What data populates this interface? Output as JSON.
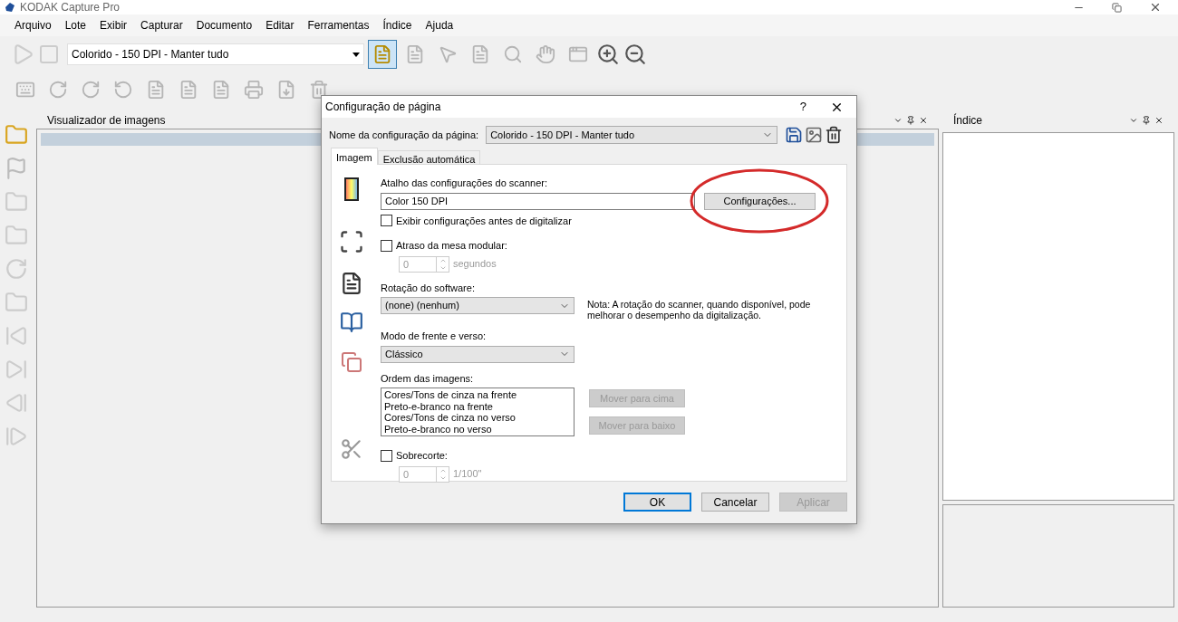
{
  "window": {
    "title": "KODAK Capture Pro"
  },
  "menu": [
    "Arquivo",
    "Lote",
    "Exibir",
    "Capturar",
    "Documento",
    "Editar",
    "Ferramentas",
    "Índice",
    "Ajuda"
  ],
  "toolbar": {
    "setup_combo": "Colorido - 150 DPI - Manter tudo"
  },
  "viewer_panel": {
    "title": "Visualizador de imagens"
  },
  "index_panel": {
    "title": "Índice"
  },
  "dialog": {
    "title": "Configuração de página",
    "help": "?",
    "name_label": "Nome da configuração da página:",
    "name_value": "Colorido - 150 DPI - Manter tudo",
    "tabs": [
      {
        "label": "Imagem",
        "selected": true
      },
      {
        "label": "Exclusão automática",
        "selected": false
      }
    ],
    "scanner": {
      "label": "Atalho das configurações do scanner:",
      "value": "Color 150 DPI",
      "button": "Configurações...",
      "show_before": {
        "label": "Exibir configurações antes de digitalizar",
        "checked": false
      }
    },
    "flatbed": {
      "label": "Atraso da mesa modular:",
      "checked": false,
      "value": "0",
      "unit": "segundos",
      "disabled": true
    },
    "rotation": {
      "label": "Rotação do software:",
      "value": "(none) (nenhum)",
      "note": "Nota: A rotação do scanner, quando disponível, pode melhorar o desempenho da digitalização."
    },
    "duplex": {
      "label": "Modo de frente e verso:",
      "value": "Clássico"
    },
    "order": {
      "label": "Ordem das imagens:",
      "items": [
        "Cores/Tons de cinza na frente",
        "Preto-e-branco na frente",
        "Cores/Tons de cinza no verso",
        "Preto-e-branco no verso"
      ],
      "buttons": [
        {
          "label": "Mover para cima",
          "disabled": true
        },
        {
          "label": "Mover para baixo",
          "disabled": true
        }
      ]
    },
    "overscan": {
      "label": "Sobrecorte:",
      "checked": false,
      "value": "0",
      "unit": "1/100\"",
      "disabled": true
    },
    "buttons": [
      {
        "label": "OK",
        "kind": "default",
        "disabled": false
      },
      {
        "label": "Cancelar",
        "kind": "normal",
        "disabled": false
      },
      {
        "label": "Aplicar",
        "kind": "normal",
        "disabled": true
      }
    ]
  }
}
